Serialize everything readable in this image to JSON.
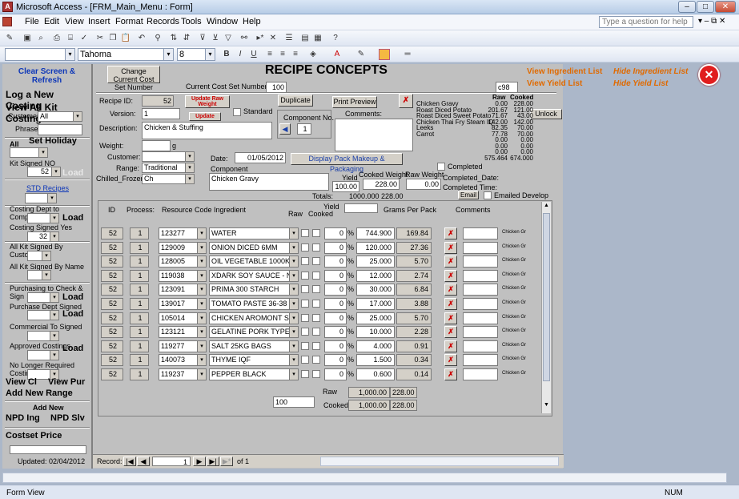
{
  "window": {
    "title": "Microsoft Access - [FRM_Main_Menu : Form]"
  },
  "menu": [
    "File",
    "Edit",
    "View",
    "Insert",
    "Format",
    "Records",
    "Tools",
    "Window",
    "Help"
  ],
  "ask": {
    "placeholder": "Type a question for help"
  },
  "format": {
    "font": "Tahoma",
    "size": "8"
  },
  "left": {
    "clear": "Clear Screen & Refresh",
    "log_new": "Log a New Costing",
    "view_all": "View All Kit Costing",
    "customer_label": "Customer",
    "customer_value": "All",
    "phrase_label": "Phrase",
    "all_label": "All",
    "set_holiday": "Set Holiday",
    "kit_signed_label": "Kit Signed NO",
    "kit_signed_value": "52",
    "load": "Load",
    "std_recipes": "STD Recipes",
    "costing_dept": "Costing Dept to Complete",
    "costing_signed": "Costing Signed Yes",
    "costing_signed_value": "32",
    "all_kit_customer": "All Kit Signed By Customer",
    "all_kit_name": "All Kit Signed By Name",
    "purchasing": "Purchasing to Check & Sign",
    "purchase_dept": "Purchase Dept Signed",
    "commercial": "Commercial To Signed",
    "approved": "Approved Costings",
    "no_longer": "No Longer Required Costings",
    "view_cl": "View Cl",
    "view_pur": "View Pur",
    "add_range": "Add New Range",
    "add_new": "Add New",
    "npd_ing": "NPD Ing",
    "npd_slv": "NPD Slv",
    "costset_price": "Costset Price",
    "updated": "Updated:  02/04/2012"
  },
  "header": {
    "change_cost": "Change Current Cost Set Number",
    "title": "RECIPE CONCEPTS",
    "current_cost_label": "Current Cost Set Number:",
    "current_cost_value": "100",
    "code": "c98",
    "view_ingredient": "View Ingredient List",
    "hide_ingredient": "Hide Ingredient List",
    "view_yield": "View Yield List",
    "hide_yield": "Hide Yield List"
  },
  "recipe": {
    "id_label": "Recipe ID:",
    "id_value": "52",
    "update_raw": "Update Raw Weight",
    "update": "Update",
    "version_label": "Version:",
    "version_value": "1",
    "standard": "Standard",
    "duplicate": "Duplicate",
    "print_preview": "Print Preview",
    "comments_label": "Comments:",
    "component_no_label": "Component No.",
    "component_no_value": "1",
    "description_label": "Description:",
    "description_value": "Chicken & Stuffing",
    "weight_label": "Weight:",
    "weight_unit": "g",
    "customer_label": "Customer:",
    "range_label": "Range:",
    "range_value": "Traditional",
    "chilled_label": "Chilled_Frozen:",
    "chilled_value": "Ch",
    "date_label": "Date:",
    "date_value": "01/05/2012",
    "display_pack": "Display Pack Makeup & Packaging",
    "component_label": "Component",
    "component_value": "Chicken Gravy",
    "yield_label": "Yield",
    "cooked_weight_label": "Cooked Weight",
    "raw_weight_label": "Raw Weight",
    "yield_value": "100.00",
    "cooked_value": "228.00",
    "raw_value": "0.00",
    "totals_label": "Totals:",
    "totals_raw": "1000.000",
    "totals_cooked": "228.00",
    "completed": "Completed",
    "completed_date": "Completed_Date:",
    "completed_time": "Completed Time:",
    "email": "Email",
    "emailed": "Emailed Develop",
    "unlock": "Unlock"
  },
  "summary": {
    "head_raw": "Raw",
    "head_cooked": "Cooked",
    "rows": [
      [
        "Chicken Gravy",
        "0.00",
        "228.00"
      ],
      [
        "Roast Diced Potato",
        "201.67",
        "121.00"
      ],
      [
        "Roast Diced Sweet Potato",
        "71.67",
        "43.00"
      ],
      [
        "Chicken Thai Fry Steam IQ",
        "142.00",
        "142.00"
      ],
      [
        "Leeks",
        "82.35",
        "70.00"
      ],
      [
        "Carrot",
        "77.78",
        "70.00"
      ],
      [
        "",
        "0.00",
        "0.00"
      ],
      [
        "",
        "0.00",
        "0.00"
      ],
      [
        "",
        "0.00",
        "0.00"
      ],
      [
        "",
        "575.464",
        "674.000"
      ]
    ]
  },
  "grid": {
    "headers": {
      "id": "ID",
      "process": "Process:",
      "resource": "Resource Code",
      "ingredient": "Ingredient",
      "raw": "Raw",
      "cooked": "Cooked",
      "yield": "Yield",
      "gpp": "Grams Per Pack",
      "comments": "Comments"
    },
    "rows": [
      {
        "id": "52",
        "proc": "1",
        "code": "123277",
        "ing": "WATER",
        "yield": "0",
        "grams": "744.900",
        "gpp": "169.84",
        "note": "Chicken Gr"
      },
      {
        "id": "52",
        "proc": "1",
        "code": "129009",
        "ing": "ONION DICED 6MM",
        "yield": "0",
        "grams": "120.000",
        "gpp": "27.36",
        "note": "Chicken Gr"
      },
      {
        "id": "52",
        "proc": "1",
        "code": "128005",
        "ing": "OIL VEGETABLE 1000KG",
        "yield": "0",
        "grams": "25.000",
        "gpp": "5.70",
        "note": "Chicken Gr"
      },
      {
        "id": "52",
        "proc": "1",
        "code": "119038",
        "ing": "XDARK SOY SAUCE - NES",
        "yield": "0",
        "grams": "12.000",
        "gpp": "2.74",
        "note": "Chicken Gr"
      },
      {
        "id": "52",
        "proc": "1",
        "code": "123091",
        "ing": "PRIMA 300 STARCH",
        "yield": "0",
        "grams": "30.000",
        "gpp": "6.84",
        "note": "Chicken Gr"
      },
      {
        "id": "52",
        "proc": "1",
        "code": "139017",
        "ing": "TOMATO PASTE 36-38 BR",
        "yield": "0",
        "grams": "17.000",
        "gpp": "3.88",
        "note": "Chicken Gr"
      },
      {
        "id": "52",
        "proc": "1",
        "code": "105014",
        "ing": "CHICKEN AROMONT STO",
        "yield": "0",
        "grams": "25.000",
        "gpp": "5.70",
        "note": "Chicken Gr"
      },
      {
        "id": "52",
        "proc": "1",
        "code": "123121",
        "ing": "GELATINE PORK TYPE A",
        "yield": "0",
        "grams": "10.000",
        "gpp": "2.28",
        "note": "Chicken Gr"
      },
      {
        "id": "52",
        "proc": "1",
        "code": "119277",
        "ing": "SALT 25KG BAGS",
        "yield": "0",
        "grams": "4.000",
        "gpp": "0.91",
        "note": "Chicken Gr"
      },
      {
        "id": "52",
        "proc": "1",
        "code": "140073",
        "ing": "THYME IQF",
        "yield": "0",
        "grams": "1.500",
        "gpp": "0.34",
        "note": "Chicken Gr"
      },
      {
        "id": "52",
        "proc": "1",
        "code": "119237",
        "ing": "PEPPER BLACK",
        "yield": "0",
        "grams": "0.600",
        "gpp": "0.14",
        "note": "Chicken Gr"
      }
    ],
    "pct": "%",
    "footer_pct": "100",
    "raw_label": "Raw",
    "raw_total": "1,000.00",
    "raw_pack": "228.00",
    "cooked_label": "Cooked",
    "cooked_total": "1,000.00",
    "cooked_pack": "228.00"
  },
  "nav": {
    "record_label": "Record:",
    "current": "1",
    "of": "of  1"
  },
  "status": {
    "left": "Form View",
    "num": "NUM"
  }
}
